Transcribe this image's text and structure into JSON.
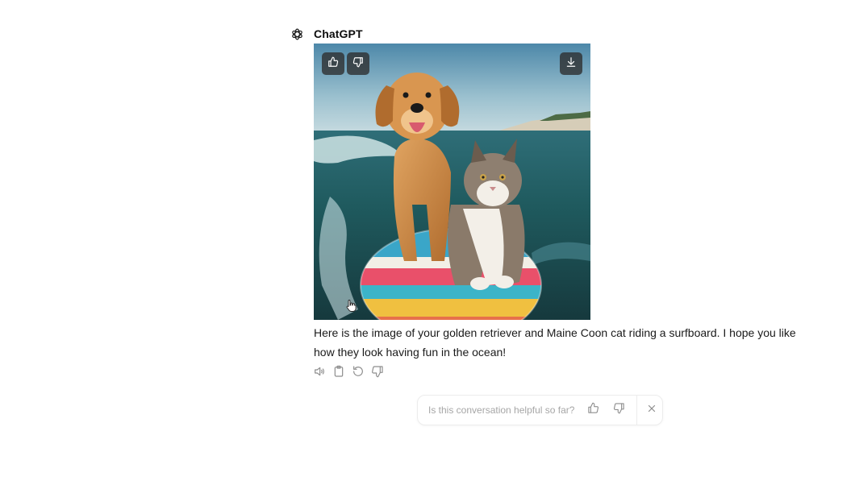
{
  "assistant": {
    "name": "ChatGPT",
    "logo_icon": "openai-logo-icon"
  },
  "image": {
    "subject": "golden retriever and Maine Coon cat riding a surfboard",
    "buttons": {
      "like_icon": "thumbs-up-icon",
      "dislike_icon": "thumbs-down-icon",
      "download_icon": "download-icon"
    }
  },
  "message": {
    "text": "Here is the image of your golden retriever and Maine Coon cat riding a surfboard. I hope you like how they look having fun in the ocean!"
  },
  "message_actions": [
    {
      "icon": "speaker-icon"
    },
    {
      "icon": "clipboard-icon"
    },
    {
      "icon": "regenerate-icon"
    },
    {
      "icon": "thumbs-down-icon"
    }
  ],
  "feedback": {
    "question": "Is this conversation helpful so far?",
    "up_icon": "thumbs-up-icon",
    "down_icon": "thumbs-down-icon",
    "close_icon": "close-icon"
  },
  "colors": {
    "text": "#1a1a1a",
    "muted": "#a6a6a6",
    "icon": "#8e8e8e",
    "border": "#ececec",
    "image_button_bg": "#2d2d2d"
  }
}
